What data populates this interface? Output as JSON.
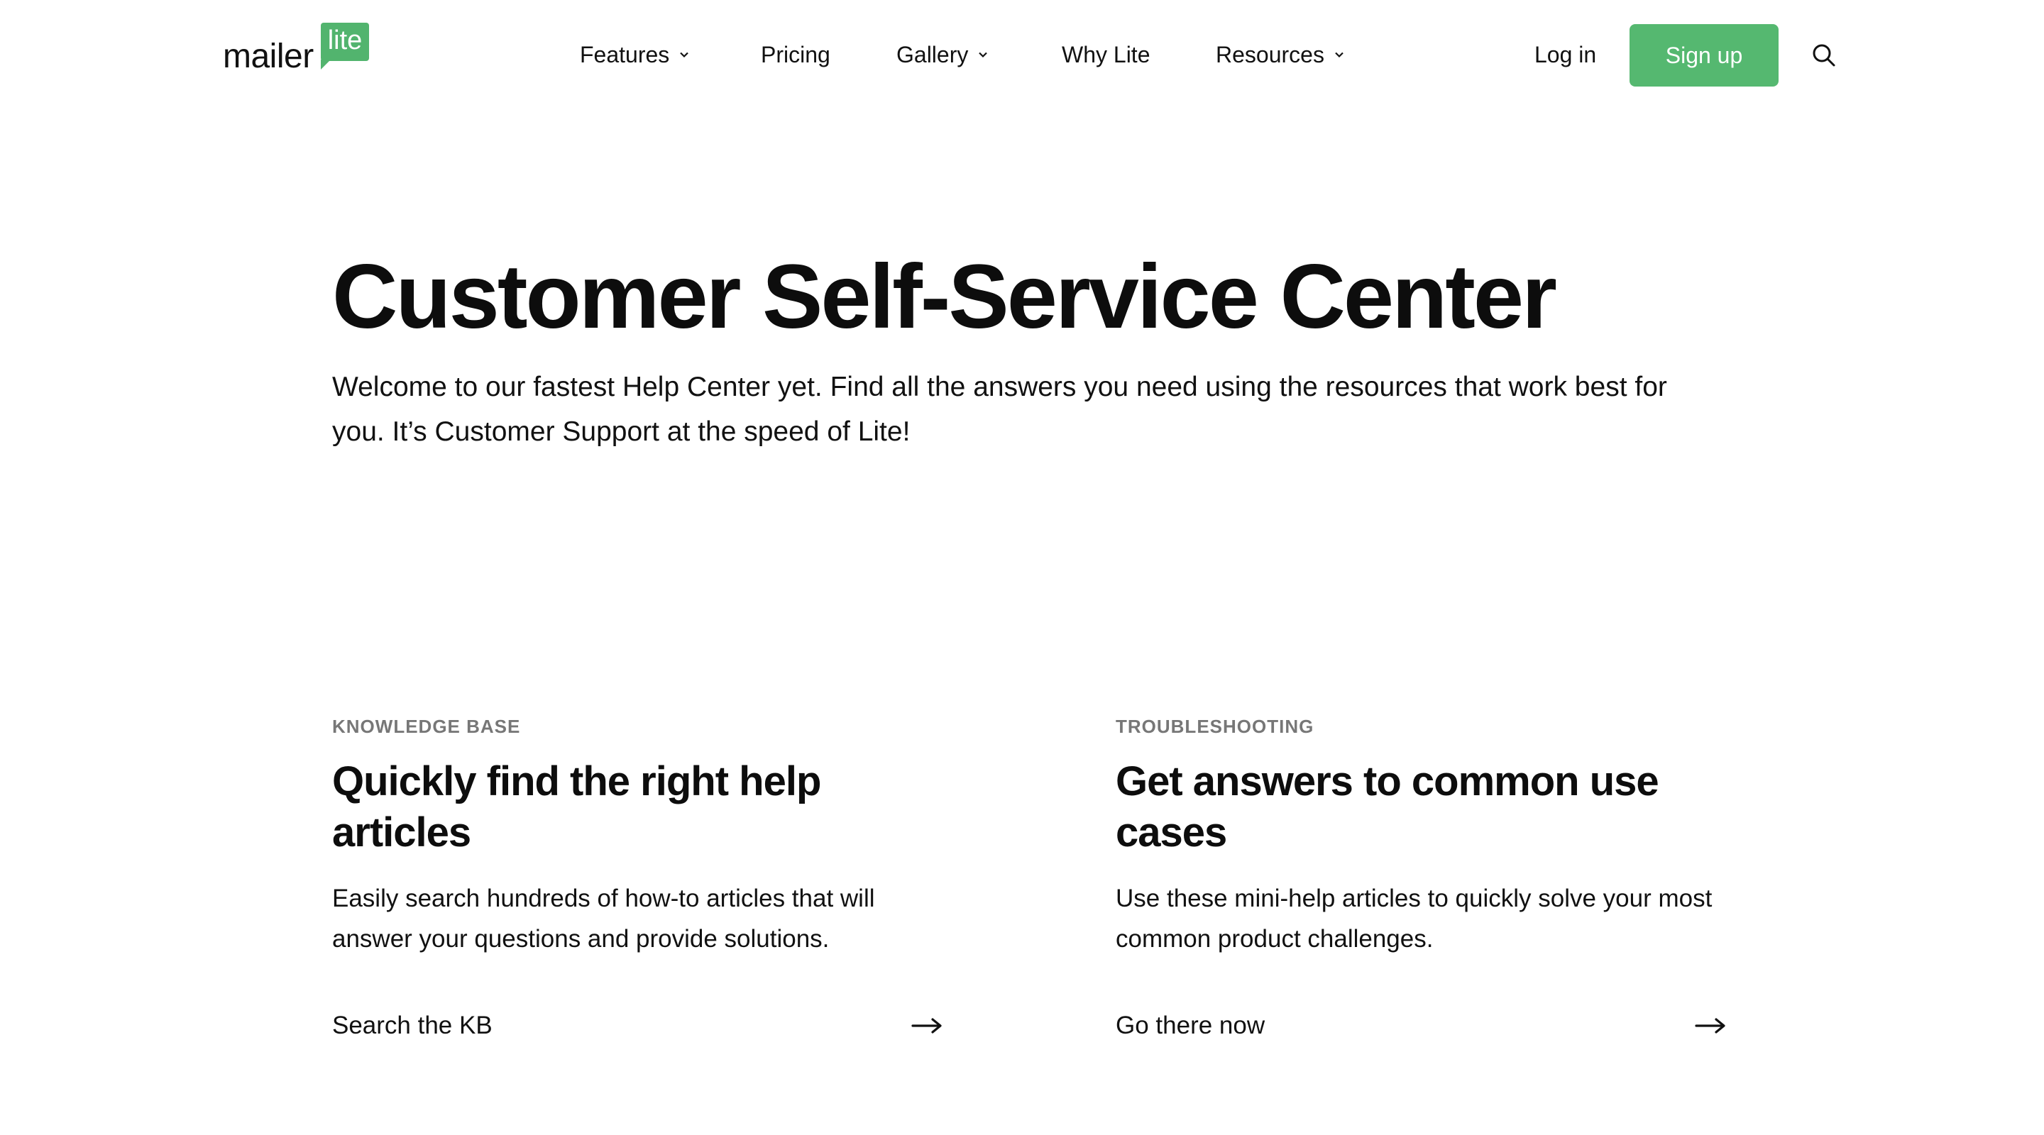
{
  "header": {
    "logo": {
      "word": "mailer",
      "badge": "lite"
    },
    "nav": [
      {
        "label": "Features",
        "has_dropdown": true
      },
      {
        "label": "Pricing",
        "has_dropdown": false
      },
      {
        "label": "Gallery",
        "has_dropdown": true
      },
      {
        "label": "Why Lite",
        "has_dropdown": false
      },
      {
        "label": "Resources",
        "has_dropdown": true
      }
    ],
    "login_label": "Log in",
    "signup_label": "Sign up",
    "search_icon": "search-icon"
  },
  "hero": {
    "title": "Customer Self-Service Center",
    "subtitle": "Welcome to our fastest Help Center yet. Find all the answers you need using the resources that work best for you. It’s Customer Support at the speed of Lite!"
  },
  "cards": [
    {
      "eyebrow": "KNOWLEDGE BASE",
      "title": "Quickly find the right help articles",
      "description": "Easily search hundreds of how-to articles that will answer your questions and provide solutions.",
      "link_label": "Search the KB",
      "link_icon": "arrow-right-icon"
    },
    {
      "eyebrow": "TROUBLESHOOTING",
      "title": "Get answers to common use cases",
      "description": "Use these mini-help articles to quickly solve your most common product challenges.",
      "link_label": "Go there now",
      "link_icon": "arrow-right-icon"
    }
  ],
  "colors": {
    "brand_green": "#55b870",
    "text": "#111111",
    "eyebrow": "#777777",
    "background": "#ffffff"
  }
}
